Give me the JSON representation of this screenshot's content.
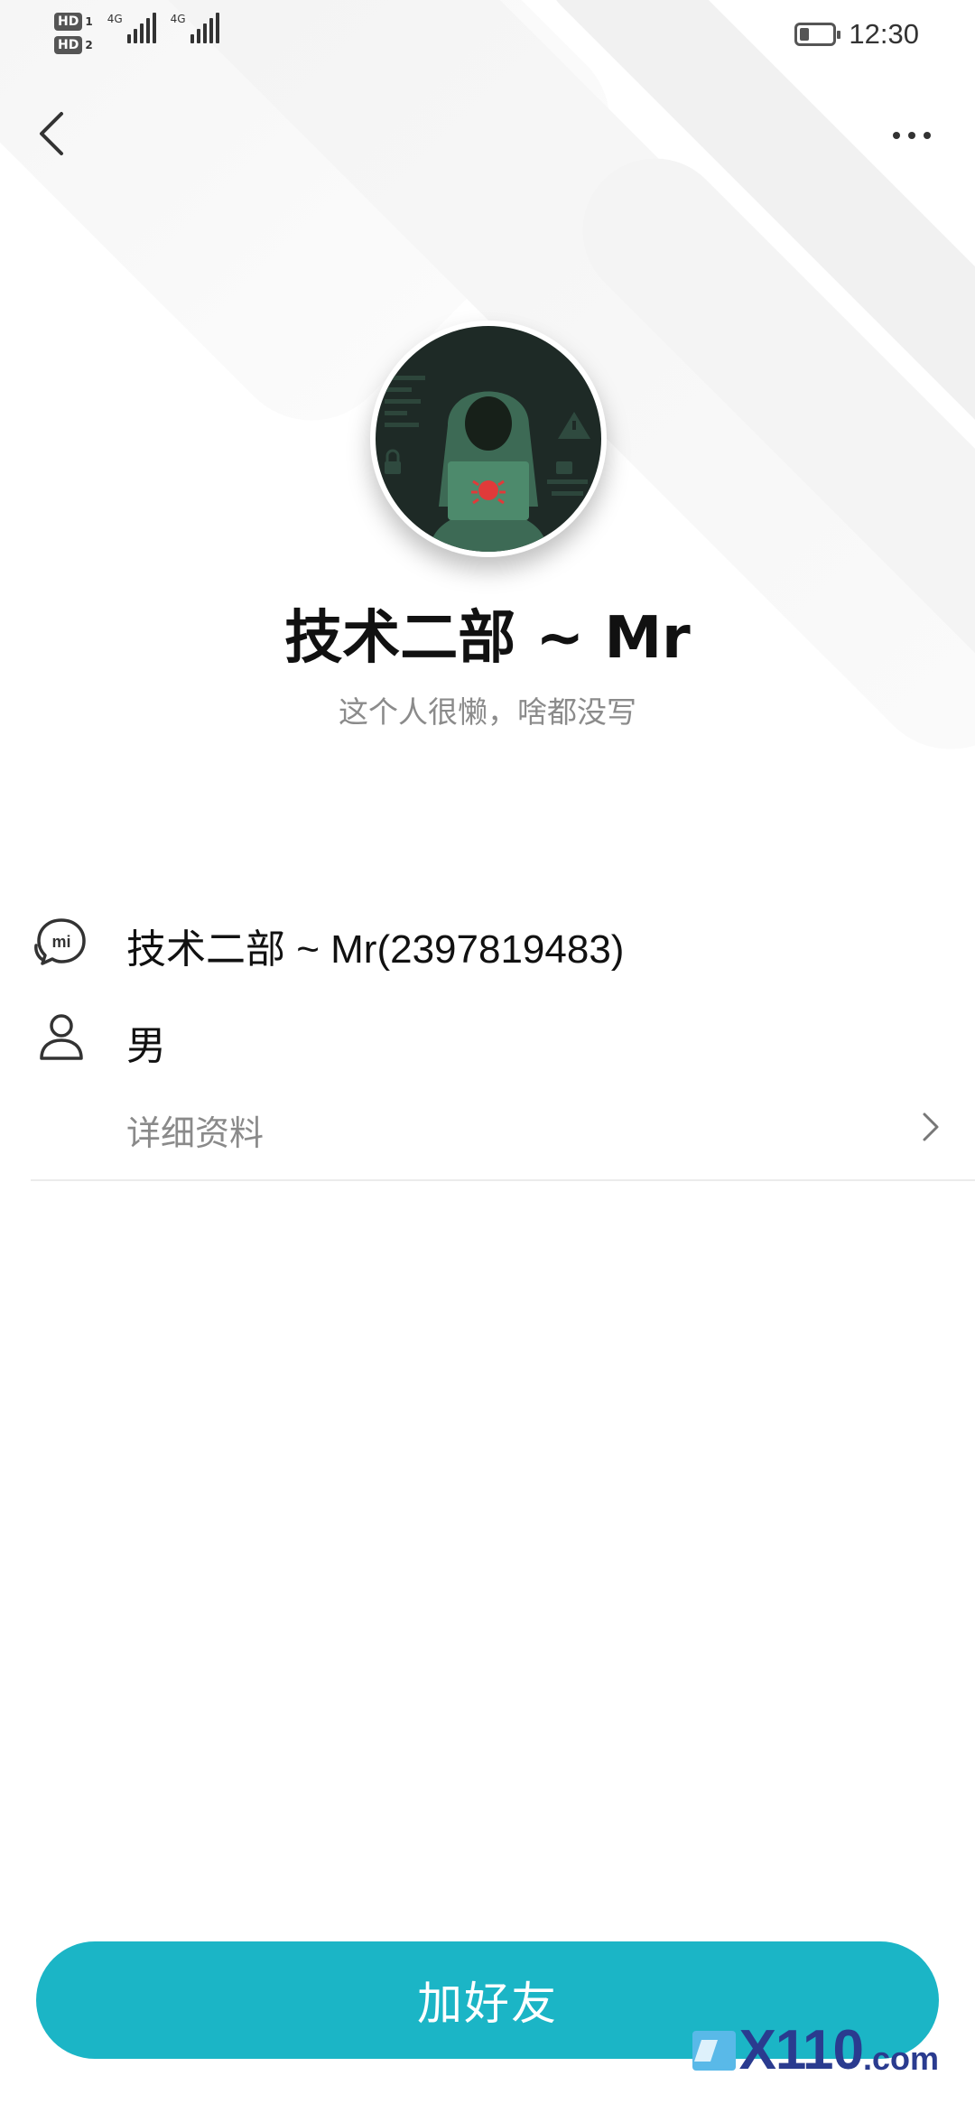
{
  "status_bar": {
    "sim1_label": "HD",
    "sim1_num": "1",
    "sim2_label": "HD",
    "sim2_num": "2",
    "network1": "4G",
    "network2": "4G",
    "battery_level": 0.3,
    "time": "12:30"
  },
  "header": {
    "back_icon": "chevron-left-icon",
    "more_icon": "more-horizontal-icon"
  },
  "profile": {
    "avatar_description": "hooded hacker with laptop",
    "name": "技术二部 ~ Mr",
    "bio": "这个人很懒，啥都没写"
  },
  "info": {
    "account_icon": "mi-chat-icon",
    "account_text": "技术二部 ~ Mr(2397819483)",
    "gender_icon": "person-icon",
    "gender_text": "男",
    "details_label": "详细资料",
    "details_icon": "chevron-right-icon"
  },
  "action": {
    "add_friend_label": "加好友"
  },
  "colors": {
    "accent": "#1bb5c6",
    "watermark": "#2a3b8f"
  },
  "watermark": {
    "logo_text": "X110",
    "domain": ".com"
  }
}
